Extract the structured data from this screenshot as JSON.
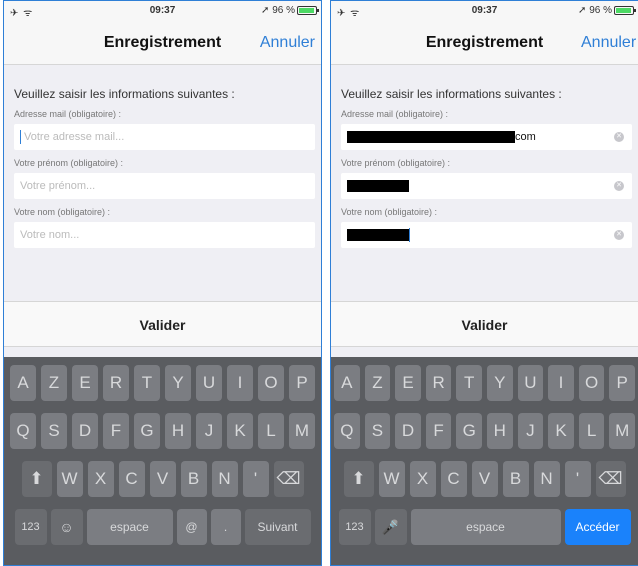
{
  "left": {
    "status": {
      "signal": "✈ ᯤ",
      "time": "09:37",
      "battery_text": "➚ 96 %"
    },
    "nav": {
      "title": "Enregistrement",
      "cancel": "Annuler"
    },
    "form": {
      "instructions": "Veuillez saisir les informations suivantes :",
      "email_label": "Adresse mail (obligatoire) :",
      "email_placeholder": "Votre adresse mail...",
      "firstname_label": "Votre prénom (obligatoire) :",
      "firstname_placeholder": "Votre prénom...",
      "lastname_label": "Votre nom (obligatoire) :",
      "lastname_placeholder": "Votre nom..."
    },
    "validate": "Valider",
    "keyboard": {
      "row1": [
        "A",
        "Z",
        "E",
        "R",
        "T",
        "Y",
        "U",
        "I",
        "O",
        "P"
      ],
      "row2": [
        "Q",
        "S",
        "D",
        "F",
        "G",
        "H",
        "J",
        "K",
        "L",
        "M"
      ],
      "row3": [
        "W",
        "X",
        "C",
        "V",
        "B",
        "N",
        "'"
      ],
      "num_key": "123",
      "emoji_key": "☺",
      "space": "espace",
      "globe_key": "@",
      "dot_key": ".",
      "action": "Suivant"
    }
  },
  "right": {
    "status": {
      "signal": "✈ ᯤ",
      "time": "09:37",
      "battery_text": "➚ 96 %"
    },
    "nav": {
      "title": "Enregistrement",
      "cancel": "Annuler"
    },
    "form": {
      "instructions": "Veuillez saisir les informations suivantes :",
      "email_label": "Adresse mail (obligatoire) :",
      "email_suffix": "com",
      "firstname_label": "Votre prénom (obligatoire) :",
      "lastname_label": "Votre nom (obligatoire) :"
    },
    "validate": "Valider",
    "keyboard": {
      "row1": [
        "A",
        "Z",
        "E",
        "R",
        "T",
        "Y",
        "U",
        "I",
        "O",
        "P"
      ],
      "row2": [
        "Q",
        "S",
        "D",
        "F",
        "G",
        "H",
        "J",
        "K",
        "L",
        "M"
      ],
      "row3": [
        "W",
        "X",
        "C",
        "V",
        "B",
        "N",
        "'"
      ],
      "num_key": "123",
      "mic_key": "🎤",
      "space": "espace",
      "action": "Accéder"
    }
  },
  "colors": {
    "accent": "#2f7fd6",
    "keyboard_bg": "#5a5c60",
    "action_blue": "#1a82fb",
    "battery_green": "#4cd964"
  },
  "icons": {
    "battery": "battery-icon",
    "clear": "clear-icon",
    "shift": "shift-icon",
    "delete": "delete-icon"
  }
}
